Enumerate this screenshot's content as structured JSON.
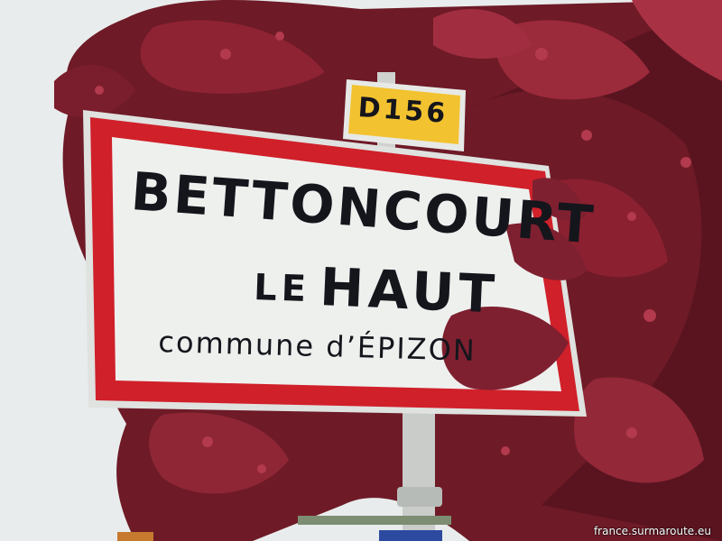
{
  "sign": {
    "line1": "BETTONCOURT",
    "line2_small": "LE",
    "line2_big": "HAUT",
    "line3": "commune d’ÉPIZON"
  },
  "road_plate": {
    "label": "D156"
  },
  "watermark": "france.surmaroute.eu",
  "colors": {
    "sign_border": "#d0202a",
    "sign_face": "#eef0ee",
    "plate_yellow": "#f2c230",
    "foliage": "#7a1c2a",
    "sky": "#e9ecec"
  }
}
